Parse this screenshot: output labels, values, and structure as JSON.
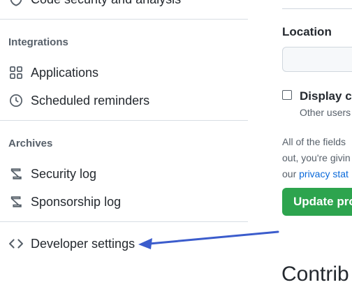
{
  "sidebar": {
    "partial_top_item": {
      "label": "Code security and analysis",
      "icon": "shield-lock-icon"
    },
    "sections": [
      {
        "title": "Integrations",
        "items": [
          {
            "label": "Applications",
            "icon": "apps-icon"
          },
          {
            "label": "Scheduled reminders",
            "icon": "clock-icon"
          }
        ]
      },
      {
        "title": "Archives",
        "items": [
          {
            "label": "Security log",
            "icon": "log-icon"
          },
          {
            "label": "Sponsorship log",
            "icon": "log-icon"
          }
        ]
      }
    ],
    "developer_settings": {
      "label": "Developer settings",
      "icon": "code-icon"
    }
  },
  "main": {
    "location": {
      "label": "Location",
      "value": "",
      "placeholder": ""
    },
    "display_checkbox": {
      "label": "Display cu",
      "help": "Other users",
      "checked": false
    },
    "note": {
      "line1": "All of the fields",
      "line2": "out, you're givin",
      "line3_prefix": "our ",
      "privacy_link": "privacy stat"
    },
    "update_button": "Update pro",
    "contributions_heading": "Contrib"
  },
  "colors": {
    "accent_green": "#2da44e",
    "link_blue": "#0969da",
    "annotation_arrow": "#3b5ccc"
  }
}
